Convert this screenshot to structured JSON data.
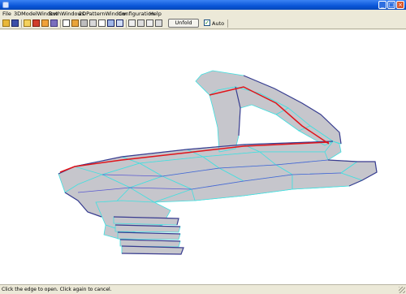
{
  "window": {
    "title": "",
    "minimize_glyph": "_",
    "maximize_glyph": "□",
    "close_glyph": "×"
  },
  "menu": [
    {
      "label": "File"
    },
    {
      "label": "3DModelWindow"
    },
    {
      "label": "BothWindows"
    },
    {
      "label": "2DPatternWindow"
    },
    {
      "label": "Configuration"
    },
    {
      "label": "Help"
    }
  ],
  "toolbar": {
    "unfold_label": "Unfold",
    "auto_label": "Auto",
    "auto_checked": true,
    "icons": [
      "open-folder-icon",
      "save-icon",
      "undo-icon",
      "redo-icon",
      "cube-icon",
      "wireframe-icon",
      "select-icon",
      "pencil-icon",
      "face-icon",
      "edge-icon",
      "join-icon",
      "split-icon",
      "flap-icon",
      "view-icon",
      "rotate-icon",
      "zoom-icon",
      "pan-icon",
      "layout-icon",
      "fit-icon",
      "text-icon",
      "grid-icon",
      "image-icon",
      "move-icon",
      "scale-icon",
      "flip-icon",
      "window-1-icon",
      "window-2-icon"
    ]
  },
  "status": {
    "text": "Click the edge to open.  Click again to cancel."
  },
  "colors": {
    "face": "#c6c6cc",
    "edge": "#3fe0e0",
    "outline": "#3b3b8f",
    "cut_edge": "#e0141a",
    "titlebar": "#0a56d8"
  }
}
